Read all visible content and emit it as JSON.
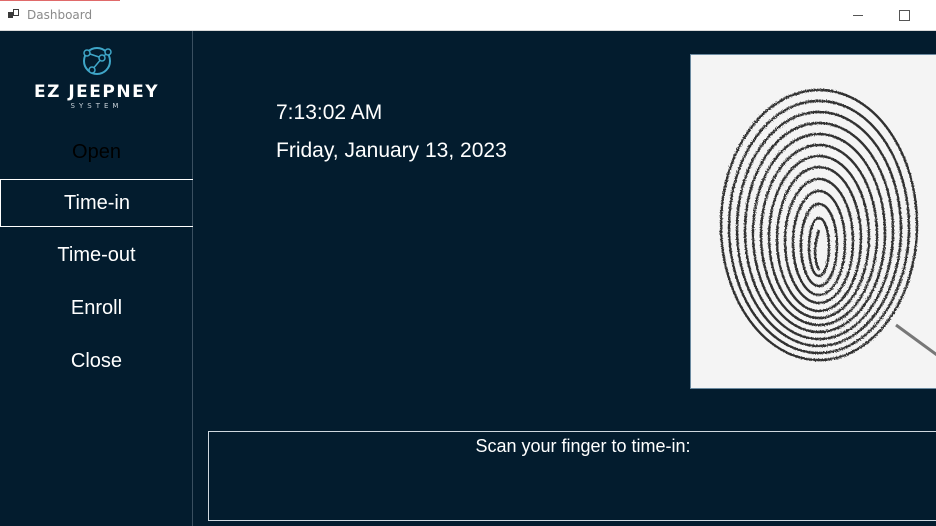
{
  "window": {
    "title": "Dashboard"
  },
  "sidebar": {
    "logo": {
      "name": "EZ JEEPNEY",
      "subtitle": "SYSTEM"
    },
    "items": [
      {
        "label": "Open",
        "state": "disabled"
      },
      {
        "label": "Time-in",
        "state": "selected"
      },
      {
        "label": "Time-out",
        "state": "normal"
      },
      {
        "label": "Enroll",
        "state": "normal"
      },
      {
        "label": "Close",
        "state": "normal"
      }
    ]
  },
  "main": {
    "time": "7:13:02 AM",
    "date": "Friday, January 13, 2023",
    "fingerprint_image": "fingerprint-scan",
    "message": "Scan your finger to time-in:"
  },
  "colors": {
    "background": "#031c2e",
    "text": "#ffffff",
    "logo_accent": "#3fa6c8"
  }
}
